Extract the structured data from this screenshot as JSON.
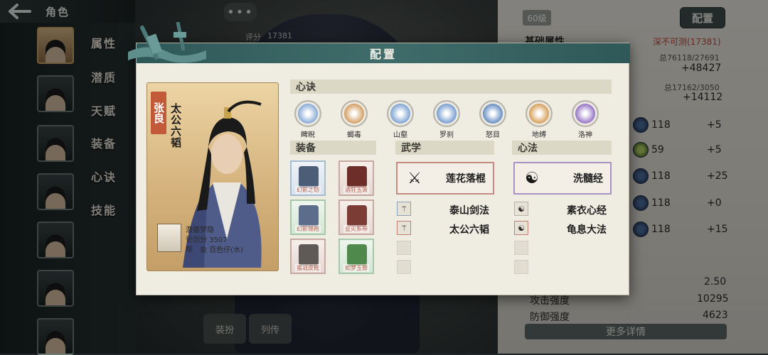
{
  "topbar": {
    "title": "角色"
  },
  "side_menu": [
    "属性",
    "潜质",
    "天赋",
    "装备",
    "心诀",
    "技能"
  ],
  "character_list": [
    "avatar-1",
    "avatar-2",
    "avatar-3",
    "avatar-4",
    "avatar-5",
    "avatar-6",
    "avatar-7"
  ],
  "background_panel": {
    "level": "60级",
    "config_button": "配置",
    "score_label": "评分",
    "score": "17381",
    "basic_attr_label": "基础属性",
    "rating": "深不可测(17381)",
    "total1": "总76118/27691",
    "bonus1": "+48427",
    "total2": "总17162/3050",
    "bonus2": "+14112",
    "skill_rows": [
      {
        "value": "118",
        "bonus": "+5"
      },
      {
        "value": "59",
        "bonus": "+5"
      },
      {
        "value": "118",
        "bonus": "+25"
      },
      {
        "value": "118",
        "bonus": "+0"
      },
      {
        "value": "118",
        "bonus": "+15"
      }
    ],
    "crit_value": "2.50",
    "attack_label": "攻击强度",
    "attack_value": "10295",
    "defense_label": "防御强度",
    "defense_value": "4623",
    "more_button": "更多详情",
    "bottom_buttons": [
      "装扮",
      "列传"
    ]
  },
  "modal": {
    "title": "配置",
    "portrait": {
      "name": "张良",
      "skill": "太公六韬",
      "info": [
        "潜循梦隐",
        "论剑分 3507",
        "帮　会 百色仔(水)"
      ]
    },
    "xinjue_header": "心诀",
    "xinjue": [
      {
        "label": "睥睨",
        "color": "#8fb0d8"
      },
      {
        "label": "蝎毒",
        "color": "#d7a36b"
      },
      {
        "label": "山壑",
        "color": "#86a9d6"
      },
      {
        "label": "罗刹",
        "color": "#7ea3d3"
      },
      {
        "label": "怒目",
        "color": "#6f94c6"
      },
      {
        "label": "地缚",
        "color": "#d9a462"
      },
      {
        "label": "洛神",
        "color": "#9c7cc9"
      }
    ],
    "equip_header": "装备",
    "equipment": [
      {
        "label": "幻影之铠",
        "quality": "blue",
        "art": "#4c5d77"
      },
      {
        "label": "酒狂玉箫",
        "quality": "red",
        "art": "#6d2d28"
      },
      {
        "label": "幻影锦袍",
        "quality": "green",
        "art": "#5c6d8c"
      },
      {
        "label": "业火系带",
        "quality": "red",
        "art": "#7b3c35"
      },
      {
        "label": "蛮战皮靴",
        "quality": "red",
        "art": "#5f5a55"
      },
      {
        "label": "如梦玉簪",
        "quality": "green",
        "art": "#4f8a4c"
      }
    ],
    "wuxue_header": "武学",
    "wuxue_main": "莲花落棍",
    "wuxue_subs": [
      "泰山剑法",
      "太公六韬"
    ],
    "xinfa_header": "心法",
    "xinfa_main": "洗髓经",
    "xinfa_subs": [
      "素衣心经",
      "龟息大法"
    ]
  }
}
